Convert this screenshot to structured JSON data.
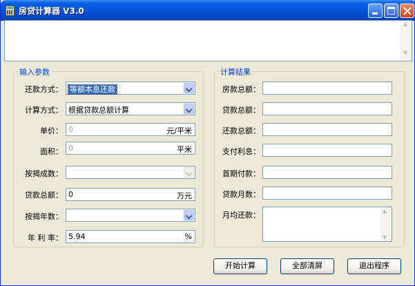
{
  "window": {
    "title": "房贷计算器 V3.0"
  },
  "input_group": {
    "legend": "输入参数",
    "repay_method": {
      "label": "还款方式：",
      "value": "等额本息还款"
    },
    "calc_method": {
      "label": "计算方式：",
      "value": "根据贷款总额计算"
    },
    "unit_price": {
      "label": "单价：",
      "value": "0",
      "unit": "元/平米"
    },
    "area": {
      "label": "面积：",
      "value": "0",
      "unit": "平米"
    },
    "down_ratio": {
      "label": "按揭成数：",
      "value": ""
    },
    "loan_total": {
      "label": "贷款总额：",
      "value": "0",
      "unit": "万元"
    },
    "loan_years": {
      "label": "按揭年数：",
      "value": ""
    },
    "annual_rate": {
      "label": "年 利 率：",
      "value": "5.94",
      "unit": "%"
    }
  },
  "result_group": {
    "legend": "计算结果",
    "house_total": {
      "label": "房款总额：",
      "value": ""
    },
    "loan_total": {
      "label": "贷款总额：",
      "value": ""
    },
    "repay_total": {
      "label": "还款总额：",
      "value": ""
    },
    "interest": {
      "label": "支付利息：",
      "value": ""
    },
    "down_payment": {
      "label": "首期付款：",
      "value": ""
    },
    "loan_months": {
      "label": "贷款月数：",
      "value": ""
    },
    "monthly": {
      "label": "月均还款：",
      "value": ""
    }
  },
  "buttons": {
    "start": "开始计算",
    "clear": "全部清屏",
    "exit": "退出程序"
  }
}
